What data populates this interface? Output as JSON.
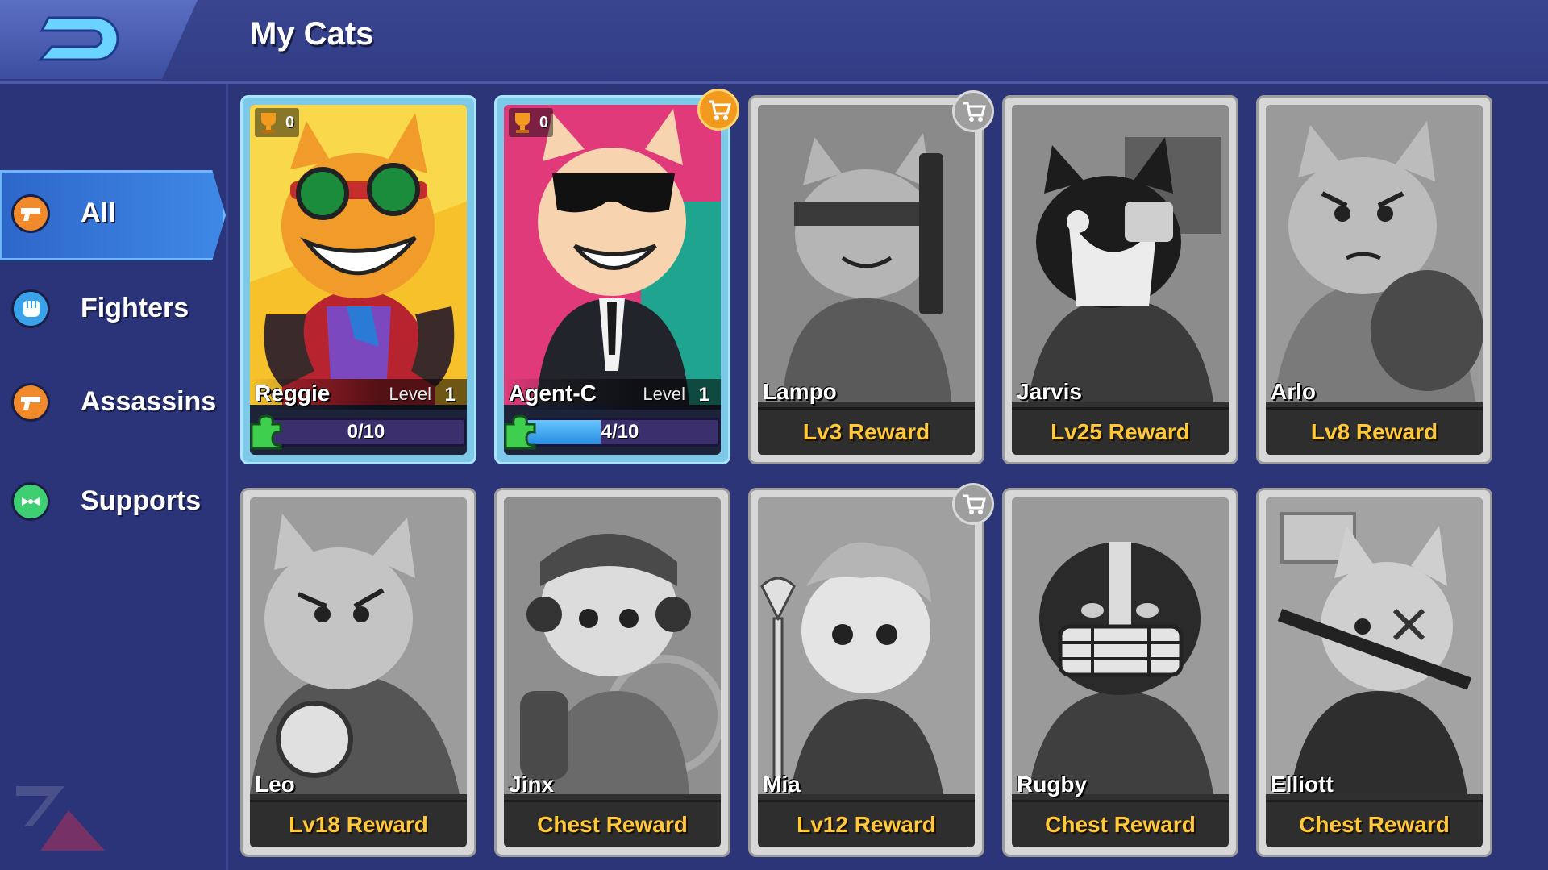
{
  "header": {
    "title": "My Cats",
    "back_icon": "back-arrow-icon"
  },
  "sidebar": {
    "items": [
      {
        "label": "All",
        "icon": "gun-icon",
        "icon_color": "#f08a2a",
        "active": true
      },
      {
        "label": "Fighters",
        "icon": "fist-icon",
        "icon_color": "#3aa2e8",
        "active": false
      },
      {
        "label": "Assassins",
        "icon": "gun-icon",
        "icon_color": "#f08a2a",
        "active": false
      },
      {
        "label": "Supports",
        "icon": "bandage-icon",
        "icon_color": "#3fcf73",
        "active": false
      }
    ]
  },
  "cats": [
    {
      "name": "Reggie",
      "owned": true,
      "trophies": "0",
      "level_label": "Level",
      "level": "1",
      "progress": "0/10",
      "progress_fraction": 0.0,
      "cart": "none"
    },
    {
      "name": "Agent-C",
      "owned": true,
      "trophies": "0",
      "level_label": "Level",
      "level": "1",
      "progress": "4/10",
      "progress_fraction": 0.4,
      "cart": "gold"
    },
    {
      "name": "Lampo",
      "owned": false,
      "reward": "Lv3 Reward",
      "cart": "gray"
    },
    {
      "name": "Jarvis",
      "owned": false,
      "reward": "Lv25 Reward",
      "cart": "none"
    },
    {
      "name": "Arlo",
      "owned": false,
      "reward": "Lv8 Reward",
      "cart": "none"
    },
    {
      "name": "Leo",
      "owned": false,
      "reward": "Lv18 Reward",
      "cart": "none"
    },
    {
      "name": "Jinx",
      "owned": false,
      "reward": "Chest Reward",
      "cart": "none"
    },
    {
      "name": "Mia",
      "owned": false,
      "reward": "Lv12 Reward",
      "cart": "gray"
    },
    {
      "name": "Rugby",
      "owned": false,
      "reward": "Chest Reward",
      "cart": "none"
    },
    {
      "name": "Elliott",
      "owned": false,
      "reward": "Chest Reward",
      "cart": "none"
    }
  ],
  "colors": {
    "background": "#2b3577",
    "active_tab": "#3f89e6",
    "reward_text": "#ffc93b",
    "owned_frame": "#7ec9e8",
    "locked_frame": "#d7d7d7"
  }
}
